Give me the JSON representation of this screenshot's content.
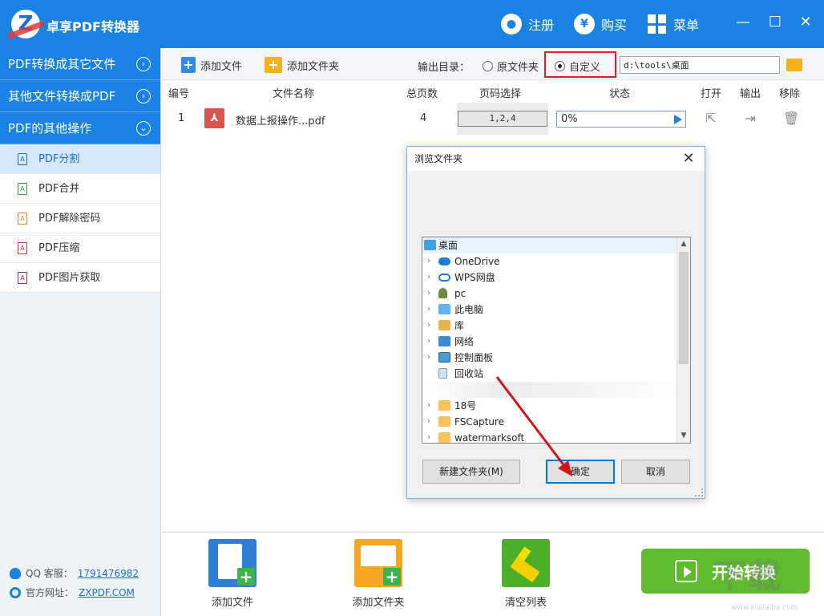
{
  "app": {
    "title": "卓享PDF转换器",
    "logo_letter": "Z",
    "register_label": "注册",
    "buy_label": "购买",
    "menu_label": "菜单",
    "accent_color": "#1a82e2"
  },
  "sidebar": {
    "categories": [
      {
        "label": "PDF转换成其它文件",
        "expanded": false
      },
      {
        "label": "其他文件转换成PDF",
        "expanded": false
      },
      {
        "label": "PDF的其他操作",
        "expanded": true
      }
    ],
    "items": [
      {
        "label": "PDF分割",
        "active": true
      },
      {
        "label": "PDF合并",
        "active": false
      },
      {
        "label": "PDF解除密码",
        "active": false
      },
      {
        "label": "PDF压缩",
        "active": false
      },
      {
        "label": "PDF图片获取",
        "active": false
      }
    ],
    "qq_label": "QQ 客服：",
    "qq_value": "1791476982",
    "site_label": "官方网址：",
    "site_value": "ZXPDF.COM"
  },
  "toolbar": {
    "add_file": "添加文件",
    "add_folder": "添加文件夹",
    "output_label": "输出目录：",
    "radio_original": "原文件夹",
    "radio_custom": "自定义",
    "selected_radio": "custom",
    "path_value": "d:\\tools\\桌面"
  },
  "table": {
    "headers": [
      "编号",
      "文件名称",
      "总页数",
      "页码选择",
      "状态",
      "打开",
      "输出",
      "移除"
    ],
    "rows": [
      {
        "index": "1",
        "name": "数据上报操作...pdf",
        "pages": "4",
        "page_select": "1,2,4",
        "status": "0%"
      }
    ]
  },
  "bottom": {
    "add_file": "添加文件",
    "add_folder": "添加文件夹",
    "clear_list": "清空列表",
    "start": "开始转换",
    "start_color": "#5dbb2c"
  },
  "dialog": {
    "title": "浏览文件夹",
    "tree": [
      {
        "label": "桌面",
        "icon": "desktop-icon",
        "root": true,
        "selected": true
      },
      {
        "label": "OneDrive",
        "icon": "cloud-icon"
      },
      {
        "label": "WPS网盘",
        "icon": "wps-cloud-icon"
      },
      {
        "label": "pc",
        "icon": "user-icon"
      },
      {
        "label": "此电脑",
        "icon": "computer-icon"
      },
      {
        "label": "库",
        "icon": "library-icon"
      },
      {
        "label": "网络",
        "icon": "network-icon"
      },
      {
        "label": "控制面板",
        "icon": "control-panel-icon"
      },
      {
        "label": "回收站",
        "icon": "recycle-bin-icon",
        "no_arrow": true
      },
      {
        "label": "",
        "icon": "",
        "blurred": true
      },
      {
        "label": "18号",
        "icon": "folder-icon"
      },
      {
        "label": "FSCapture",
        "icon": "folder-icon"
      },
      {
        "label": "watermarksoft",
        "icon": "folder-icon"
      }
    ],
    "new_folder": "新建文件夹(M)",
    "ok": "确定",
    "cancel": "取消"
  },
  "watermark": {
    "main": "下载",
    "url": "www.xiazaiba.com"
  }
}
